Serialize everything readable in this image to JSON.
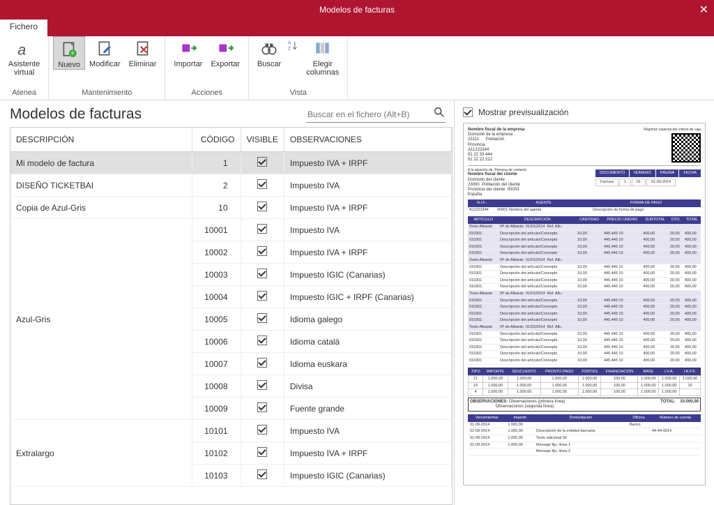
{
  "window": {
    "title": "Modelos de facturas",
    "close": "✕"
  },
  "tabs": {
    "fichero": "Fichero"
  },
  "ribbon": {
    "group1": {
      "label": "Atenea",
      "asistente": "Asistente\nvirtual"
    },
    "group2": {
      "label": "Mantenimiento",
      "nuevo": "Nuevo",
      "modificar": "Modificar",
      "eliminar": "Eliminar"
    },
    "group3": {
      "label": "Acciones",
      "importar": "Importar",
      "exportar": "Exportar"
    },
    "group4": {
      "label": "Vista",
      "buscar": "Buscar",
      "elegir": "Elegir\ncolumnas"
    }
  },
  "list": {
    "title": "Modelos de facturas",
    "search_placeholder": "Buscar en el fichero (Alt+B)",
    "headers": {
      "desc": "DESCRIPCIÓN",
      "codigo": "CÓDIGO",
      "visible": "VISIBLE",
      "obs": "OBSERVACIONES"
    },
    "rows": [
      {
        "desc": "Mi modelo de factura",
        "codigo": "1",
        "visible": true,
        "obs": "Impuesto IVA + IRPF",
        "selected": true,
        "rowspan": 1
      },
      {
        "desc": "DISEÑO TICKETBAI",
        "codigo": "2",
        "visible": true,
        "obs": "Impuesto IVA",
        "rowspan": 1
      },
      {
        "desc": "Copia de Azul-Gris",
        "codigo": "10",
        "visible": true,
        "obs": "Impuesto IVA + IRPF",
        "rowspan": 1
      },
      {
        "desc": "Azul-Gris",
        "codigo": "10001",
        "visible": true,
        "obs": "Impuesto IVA",
        "rowspan": 9
      },
      {
        "codigo": "10002",
        "visible": true,
        "obs": "Impuesto IVA + IRPF"
      },
      {
        "codigo": "10003",
        "visible": true,
        "obs": "Impuesto IGIC (Canarias)"
      },
      {
        "codigo": "10004",
        "visible": true,
        "obs": "Impuesto IGIC + IRPF (Canarias)"
      },
      {
        "codigo": "10005",
        "visible": true,
        "obs": "Idioma galego"
      },
      {
        "codigo": "10006",
        "visible": true,
        "obs": "Idioma català"
      },
      {
        "codigo": "10007",
        "visible": true,
        "obs": "Idioma euskara"
      },
      {
        "codigo": "10008",
        "visible": true,
        "obs": "Divisa"
      },
      {
        "codigo": "10009",
        "visible": true,
        "obs": "Fuente grande"
      },
      {
        "desc": "Extralargo",
        "codigo": "10101",
        "visible": true,
        "obs": "Impuesto IVA",
        "rowspan": 3
      },
      {
        "codigo": "10102",
        "visible": true,
        "obs": "Impuesto IVA + IRPF"
      },
      {
        "codigo": "10103",
        "visible": true,
        "obs": "Impuesto IGIC (Canarias)"
      }
    ]
  },
  "preview": {
    "checkbox_label": "Mostrar previsualización",
    "company": {
      "name": "Nombre fiscal de la empresa",
      "addr": "Domicilio de la empresa",
      "cp": "23111",
      "pob": "Población",
      "prov": "Provincia",
      "cif": "A11222344",
      "tel1": "91 22 33 444",
      "tel2": "91 22 22 222",
      "regimen": "Régimen especial del criterio de caja"
    },
    "client": {
      "title": "Nombre fiscal del cliente",
      "att": "A la atención de: Persona de contacto",
      "addr": "Domicilio del cliente",
      "cp": "23000",
      "pob": "Población del cliente",
      "prov": "Provincia del cliente",
      "codigo": "00003",
      "pais": "España"
    },
    "docbar": {
      "doc_h": "DOCUMENTO",
      "num_h": "NÚMERO",
      "pag_h": "PÁGINA",
      "fecha_h": "FECHA",
      "doc_v": "Factura",
      "num_v": "1",
      "pag_v": "01",
      "fecha_v": "01-09-2014"
    },
    "agent": {
      "nif_h": "N.I.F.:",
      "nif_v": "A11222344",
      "agente_h": "AGENTE",
      "agente_v": "00001   Nombre del agente",
      "forma_h": "FORMA DE PAGO",
      "forma_v": "Descripción de forma de pago"
    },
    "cols": {
      "art": "ARTÍCULO",
      "desc": "DESCRIPCIÓN",
      "cant": "CANTIDAD",
      "precio": "PRECIO UNIDAD",
      "subt": "SUBTOTAL",
      "dto": "DTO.",
      "total": "TOTAL"
    },
    "line_item": {
      "art": "010301",
      "ref": "Texto Albarán",
      "ref2": "Nº de Albarán",
      "date": "01/01/2014",
      "desc": "Descripción del artículo/Concepto",
      "cant": "10,00",
      "precio": "445.445 10",
      "subt": "400,00",
      "dto": "20,00",
      "total": "400,00"
    },
    "totals": {
      "headers": [
        "TIPO",
        "IMPORTE",
        "DESCUENTO",
        "PRONTO PAGO",
        "PORTES",
        "FINANCIACIÓN",
        "BASE",
        "I.V.A.",
        "I.R.P.F."
      ],
      "rows": [
        [
          "21",
          "1.000,00",
          "1.000,00",
          "1.000,00",
          "1.000,00",
          "100,00",
          "1.000,00",
          "1.000,00",
          "1.000,00"
        ],
        [
          "10",
          "1.000,00",
          "1.000,00",
          "1.000,00",
          "1.000,00",
          "100,00",
          "1.000,00",
          "1.000,00",
          "10"
        ],
        [
          "4",
          "1.000,00",
          "1.000,00",
          "1.000,00",
          "1.000,00",
          "100,00",
          "1.000,00",
          "1.000,00",
          ""
        ]
      ]
    },
    "obs": {
      "label": "OBSERVACIONES:",
      "l1": "Observaciones (primera línea)",
      "l2": "Observaciones (segunda línea)",
      "total_label": "TOTAL:",
      "total_val": "10.000,00"
    },
    "pay": {
      "headers": [
        "Vencimientos",
        "Importe",
        "Domiciliación",
        "Oficina",
        "Número de cuenta"
      ],
      "rows": [
        [
          "01-09-2014",
          "1.000,00",
          "",
          "Banco",
          ""
        ],
        [
          "01-09-2014",
          "1.000,00",
          "Descripción de la entidad bancaria",
          "",
          "44-44-0014"
        ],
        [
          "01-09-2014",
          "1.000,00",
          "Texto adicional 02",
          "",
          ""
        ],
        [
          "01-09-2014",
          "1.000,00",
          "Mensaje fijo, línea 1",
          "",
          ""
        ],
        [
          "",
          "",
          "Mensaje fijo, línea 2",
          "",
          ""
        ]
      ]
    }
  }
}
